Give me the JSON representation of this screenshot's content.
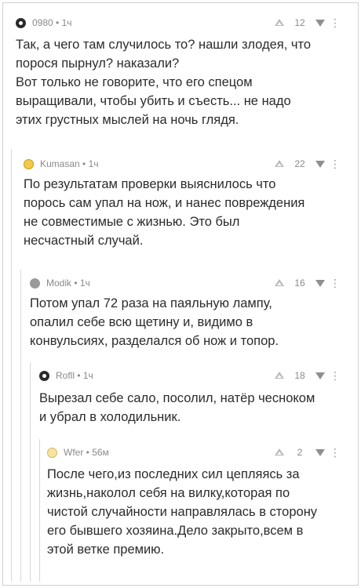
{
  "comments": [
    {
      "meta": "0980 • 1ч",
      "score": "12",
      "text": "Так, а чего там случилось то? нашли злодея, что\nпорося пырнул? наказали?\nВот только не говорите, что его спецом\nвыращивали, чтобы убить и съесть...  не надо\nэтих грустных мыслей на ночь глядя."
    },
    {
      "meta": "Kumasan • 1ч",
      "score": "22",
      "text": "По результатам проверки выяснилось что\nпорось сам упал на нож, и нанес повреждения\nне совместимые с жизнью. Это был\nнесчастный случай."
    },
    {
      "meta": "Modik • 1ч",
      "score": "16",
      "text": "Потом упал 72 раза на паяльную лампу,\nопалил себе всю щетину и, видимо в\nконвульсиях, разделался об нож и топор."
    },
    {
      "meta": "Rofll • 1ч",
      "score": "18",
      "text": "Вырезал себе сало, посолил, натёр чесноком\nи убрал в холодильник."
    },
    {
      "meta": "Wfer • 56м",
      "score": "2",
      "text": "После чего,из последних сил цепляясь за\nжизнь,наколол себя на вилку,которая по\nчистой случайности направлялась в сторону\nего бывшего хозяина.Дело закрыто,всем в\nэтой ветке премию."
    }
  ],
  "more_icon": "⋮"
}
